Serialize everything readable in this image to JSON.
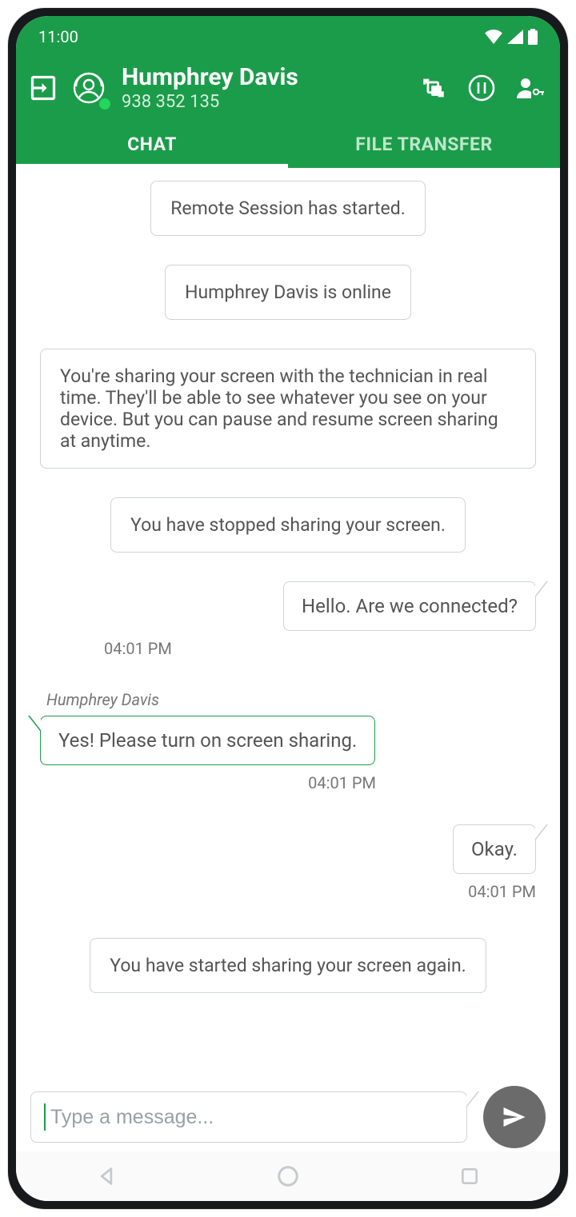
{
  "status": {
    "time": "11:00"
  },
  "header": {
    "name": "Humphrey Davis",
    "id": "938 352 135"
  },
  "tabs": {
    "chat": "CHAT",
    "file_transfer": "FILE TRANSFER"
  },
  "messages": {
    "sys1": "Remote Session has started.",
    "sys2": "Humphrey Davis is online",
    "sys3": "You're sharing your screen with the technician in real time. They'll be able to see whatever you see on your device. But you can pause and resume screen sharing at anytime.",
    "sys4": "You have stopped sharing your screen.",
    "out1": {
      "text": "Hello. Are we connected?",
      "time": "04:01 PM"
    },
    "in1": {
      "sender": "Humphrey Davis",
      "text": "Yes! Please turn on screen sharing.",
      "time": "04:01 PM"
    },
    "out2": {
      "text": "Okay.",
      "time": "04:01 PM"
    },
    "sys5": "You have started sharing your screen again."
  },
  "composer": {
    "placeholder": "Type a message..."
  }
}
